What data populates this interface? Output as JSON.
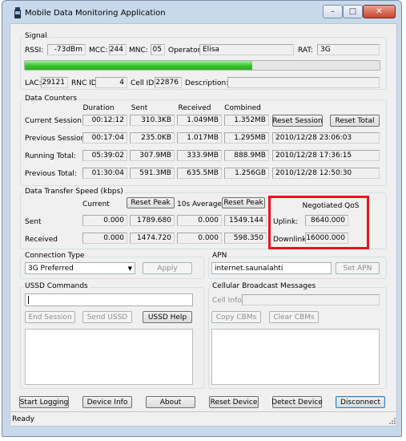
{
  "window": {
    "title": "Mobile Data Monitoring Application",
    "minimize": "–",
    "maximize": "□",
    "close": "✕"
  },
  "signal": {
    "group_title": "Signal",
    "rssi_label": "RSSI:",
    "rssi": "-73dBm",
    "mcc_label": "MCC:",
    "mcc": "244",
    "mnc_label": "MNC:",
    "mnc": "05",
    "operator_label": "Operator:",
    "operator": "Elisa",
    "rat_label": "RAT:",
    "rat": "3G",
    "strength_fraction": 0.64,
    "lac_label": "LAC:",
    "lac": "29121",
    "rnc_label": "RNC ID",
    "rnc": "4",
    "cell_label": "Cell ID",
    "cell": "22876",
    "desc_label": "Description:",
    "desc": ""
  },
  "counters": {
    "group_title": "Data Counters",
    "headers": {
      "duration": "Duration",
      "sent": "Sent",
      "received": "Received",
      "combined": "Combined"
    },
    "rows": [
      {
        "label": "Current Session:",
        "duration": "00:12:12",
        "sent": "310.3KB",
        "received": "1.049MB",
        "combined": "1.352MB"
      },
      {
        "label": "Previous Session:",
        "duration": "00:17:04",
        "sent": "235.0KB",
        "received": "1.017MB",
        "combined": "1.295MB",
        "ts": "2010/12/28 23:06:03"
      },
      {
        "label": "Running Total:",
        "duration": "05:39:02",
        "sent": "307.9MB",
        "received": "333.9MB",
        "combined": "888.9MB",
        "ts": "2010/12/28 17:36:15"
      },
      {
        "label": "Previous Total:",
        "duration": "01:30:04",
        "sent": "591.3MB",
        "received": "635.5MB",
        "combined": "1.256GB",
        "ts": "2010/12/28 12:50:30"
      }
    ],
    "reset_session": "Reset Session",
    "reset_total": "Reset Total"
  },
  "speed": {
    "group_title": "Data Transfer Speed (kbps)",
    "h_current": "Current",
    "reset_peak": "Reset Peak",
    "h_avg": "10s Average",
    "reset_peak2": "Reset Peak",
    "sent_label": "Sent",
    "recv_label": "Received",
    "sent_current": "0.000",
    "sent_peak": "1789.680",
    "sent_avg": "0.000",
    "sent_peak2": "1549.144",
    "recv_current": "0.000",
    "recv_peak": "1474.720",
    "recv_avg": "0.000",
    "recv_peak2": "598.350",
    "qos_title": "Negotiated QoS",
    "uplink_label": "Uplink:",
    "uplink": "8640.000",
    "downlink_label": "Downlink:",
    "downlink": "16000.000",
    "highlight_color": "#e8141c"
  },
  "connection": {
    "group_title": "Connection Type",
    "selected": "3G Preferred",
    "apply": "Apply"
  },
  "apn": {
    "group_title": "APN",
    "value": "internet.saunalahti",
    "set": "Set APN"
  },
  "ussd": {
    "group_title": "USSD Commands",
    "end": "End Session",
    "send": "Send USSD",
    "help": "USSD Help"
  },
  "cbm": {
    "group_title": "Cellular Broadcast Messages",
    "cell_info_label": "Cell Info:",
    "copy": "Copy CBMs",
    "clear": "Clear CBMs"
  },
  "bottom": {
    "start_logging": "Start Logging",
    "device_info": "Device Info",
    "about": "About",
    "reset_device": "Reset Device",
    "detect_device": "Detect Device",
    "disconnect": "Disconnect"
  },
  "status": {
    "text": "Ready"
  }
}
